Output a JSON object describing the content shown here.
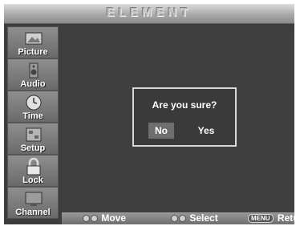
{
  "header": {
    "brand": "ELEMENT"
  },
  "sidebar": {
    "items": [
      {
        "label": "Picture",
        "icon": "picture-icon"
      },
      {
        "label": "Audio",
        "icon": "speaker-icon"
      },
      {
        "label": "Time",
        "icon": "clock-icon"
      },
      {
        "label": "Setup",
        "icon": "setup-icon"
      },
      {
        "label": "Lock",
        "icon": "lock-icon"
      },
      {
        "label": "Channel",
        "icon": "tv-icon"
      }
    ]
  },
  "dialog": {
    "title": "Are you sure?",
    "no_label": "No",
    "yes_label": "Yes",
    "selected": "No"
  },
  "footer": {
    "move_label": "Move",
    "select_label": "Select",
    "menu_key": "MENU",
    "return_label": "Return"
  }
}
